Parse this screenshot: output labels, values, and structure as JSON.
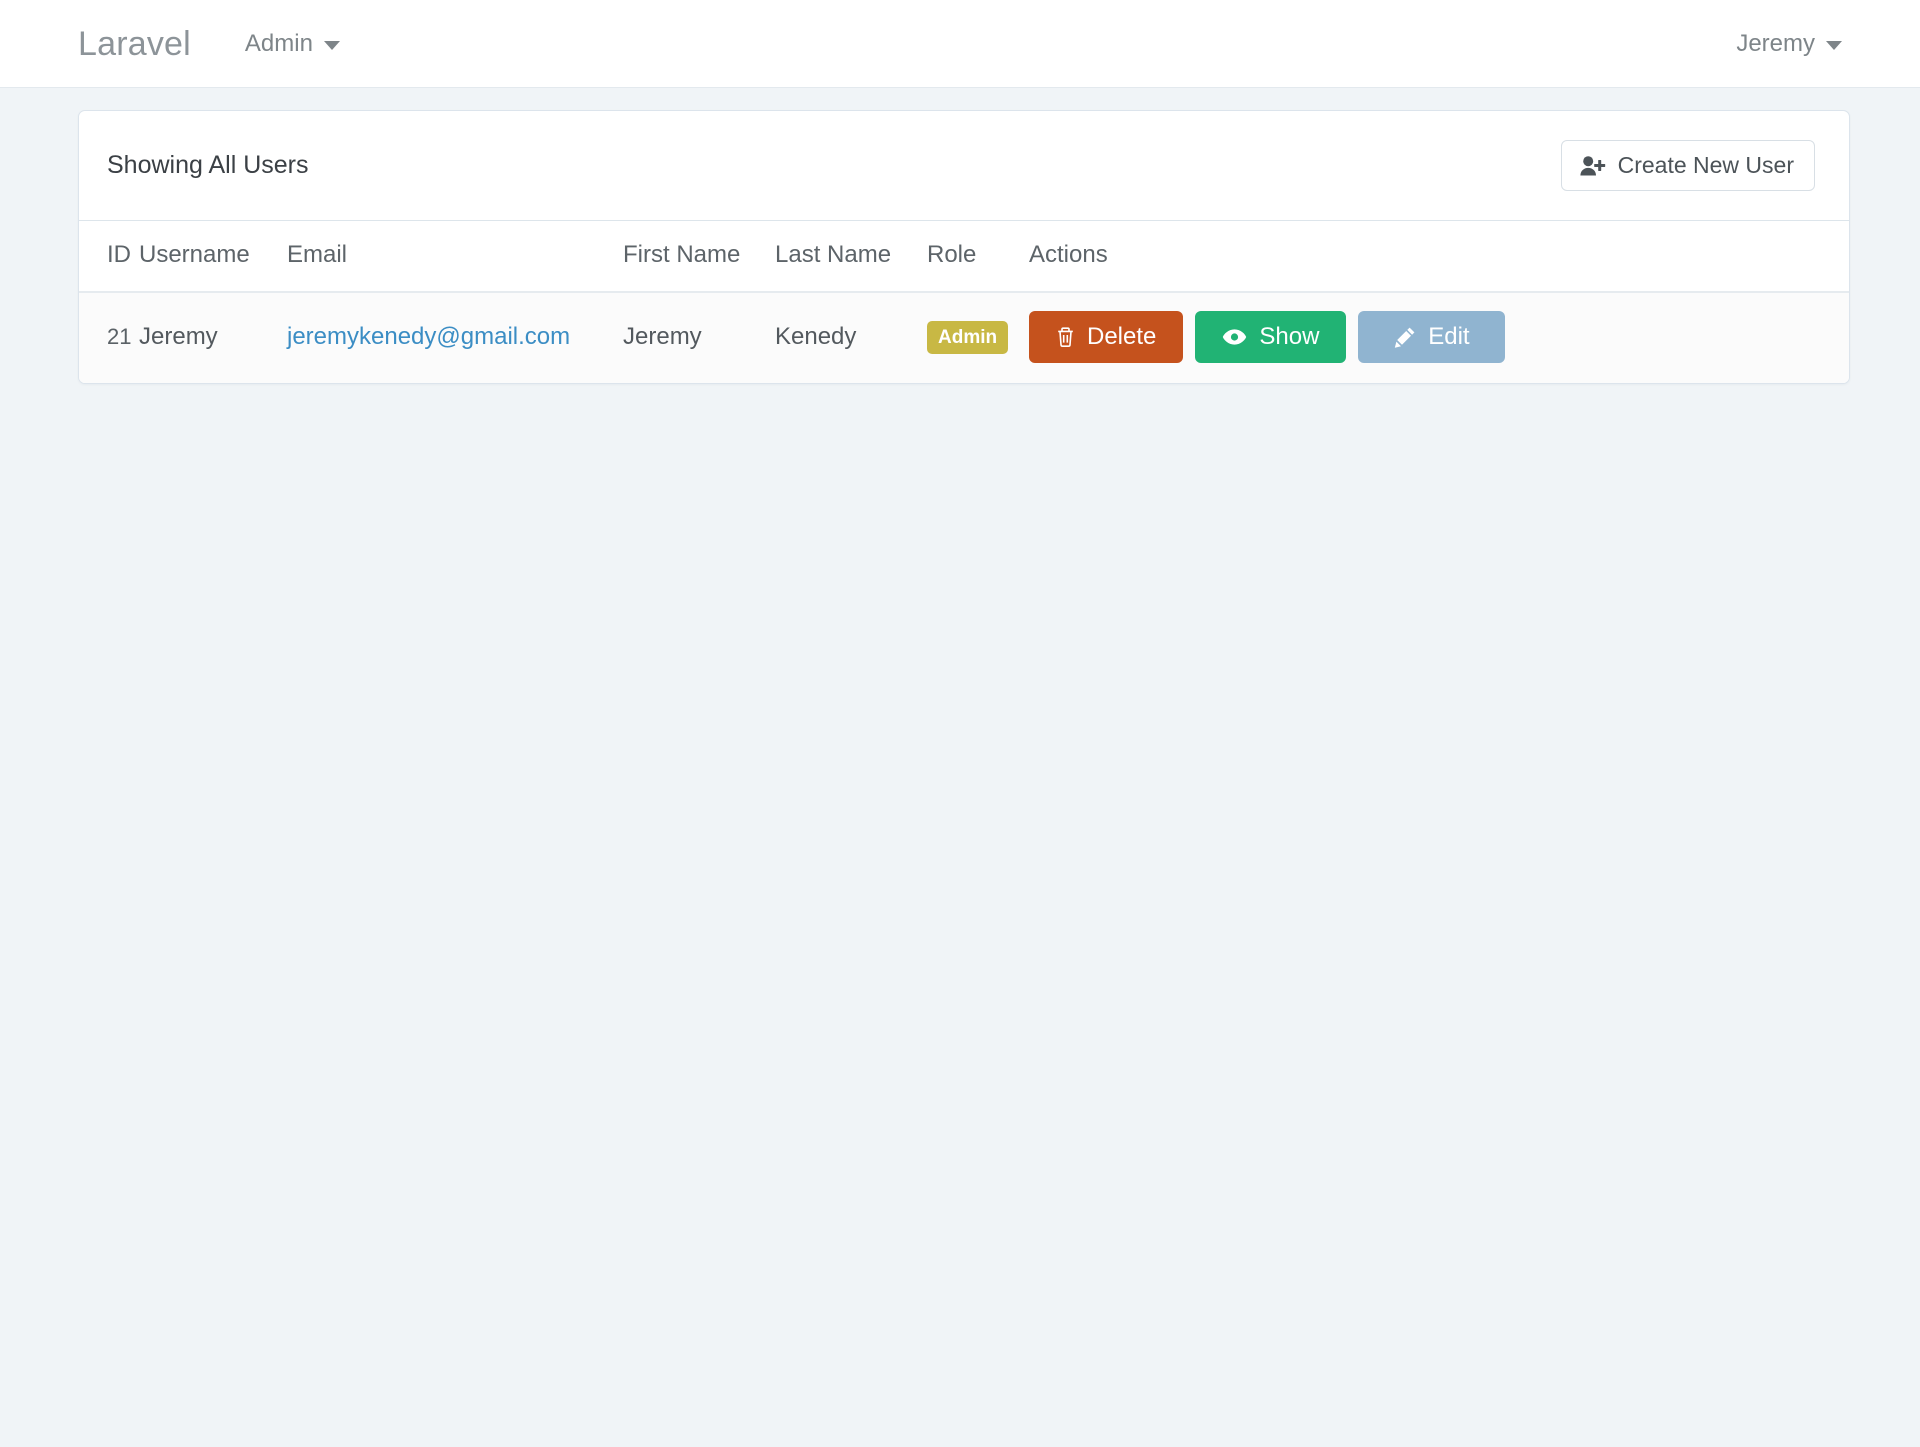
{
  "navbar": {
    "brand": "Laravel",
    "admin_menu": {
      "label": "Admin",
      "icon": "chevron-down-icon"
    },
    "user_menu": {
      "label": "Jeremy",
      "icon": "chevron-down-icon"
    }
  },
  "card": {
    "title": "Showing All Users",
    "create_button": {
      "label": "Create New User",
      "icon": "user-plus-icon"
    }
  },
  "table": {
    "columns": [
      "ID",
      "Username",
      "Email",
      "First Name",
      "Last Name",
      "Role",
      "Actions"
    ],
    "rows": [
      {
        "id": "21",
        "username": "Jeremy",
        "email": "jeremykenedy@gmail.com",
        "first_name": "Jeremy",
        "last_name": "Kenedy",
        "role": "Admin",
        "actions": [
          {
            "label": "Delete",
            "icon": "trash-icon",
            "color": "#c5521d"
          },
          {
            "label": "Show",
            "icon": "eye-icon",
            "color": "#21b374"
          },
          {
            "label": "Edit",
            "icon": "pencil-icon",
            "color": "#90b4d0"
          }
        ]
      }
    ]
  },
  "colors": {
    "page_background": "#f0f4f7",
    "card_background": "#ffffff",
    "card_border": "#dce4ec",
    "brand_text": "#8d9499",
    "link": "#3b8dc4",
    "badge_admin": "#c8b844",
    "delete": "#c5521d",
    "show": "#21b374",
    "edit": "#90b4d0"
  }
}
